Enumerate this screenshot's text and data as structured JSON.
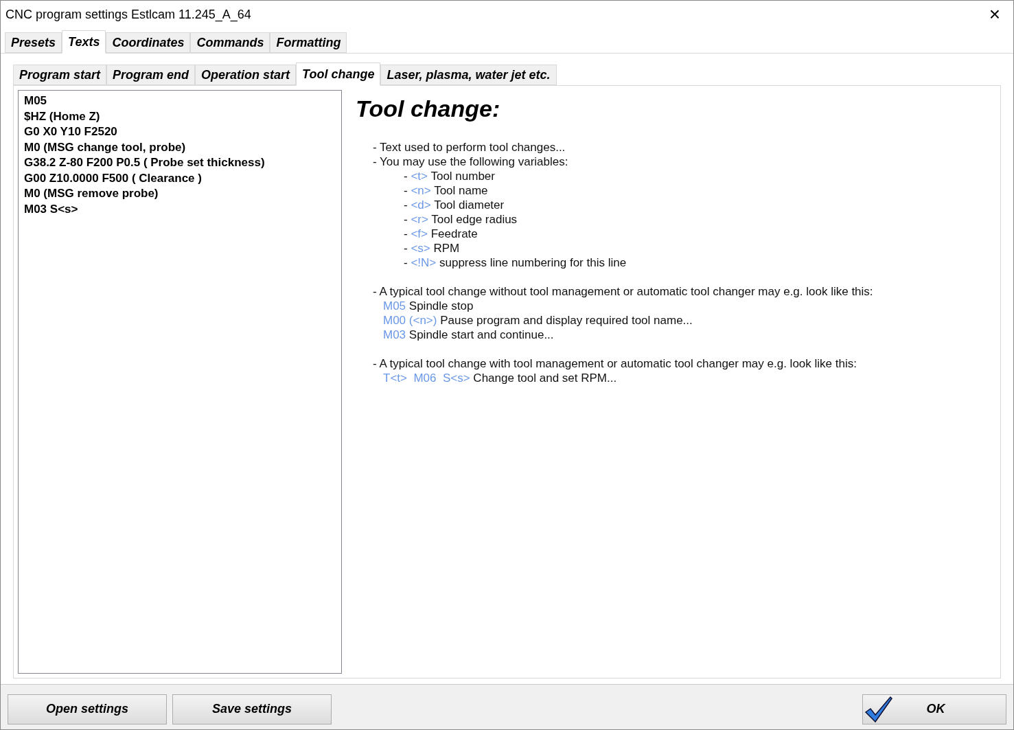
{
  "window": {
    "title": "CNC program settings Estlcam 11.245_A_64",
    "close": "×"
  },
  "tabs": [
    {
      "label": "Presets",
      "selected": false
    },
    {
      "label": "Texts",
      "selected": true
    },
    {
      "label": "Coordinates",
      "selected": false
    },
    {
      "label": "Commands",
      "selected": false
    },
    {
      "label": "Formatting",
      "selected": false
    }
  ],
  "subtabs": [
    {
      "label": "Program start",
      "selected": false
    },
    {
      "label": "Program end",
      "selected": false
    },
    {
      "label": "Operation start",
      "selected": false
    },
    {
      "label": "Tool change",
      "selected": true
    },
    {
      "label": "Laser, plasma, water jet etc.",
      "selected": false
    }
  ],
  "editor": {
    "lines": [
      "M05",
      "$HZ (Home Z)",
      "G0 X0 Y10 F2520",
      "M0 (MSG change tool, probe)",
      "G38.2 Z-80 F200 P0.5 ( Probe set thickness)",
      "G00 Z10.0000 F500 ( Clearance )",
      "M0 (MSG remove probe)",
      "M03 S<s>"
    ]
  },
  "help": {
    "title": "Tool change:",
    "lines": [
      {
        "kind": "bullet",
        "text": "- Text used to perform tool changes..."
      },
      {
        "kind": "bullet",
        "text": "- You may use the following variables:"
      },
      {
        "kind": "sub",
        "dash": "-",
        "code": "<t>",
        "text": "Tool number"
      },
      {
        "kind": "sub",
        "dash": "-",
        "code": "<n>",
        "text": "Tool name"
      },
      {
        "kind": "sub",
        "dash": "-",
        "code": "<d>",
        "text": "Tool diameter"
      },
      {
        "kind": "sub",
        "dash": "-",
        "code": "<r>",
        "text": "Tool edge radius"
      },
      {
        "kind": "sub",
        "dash": "-",
        "code": "<f>",
        "text": "Feedrate"
      },
      {
        "kind": "sub",
        "dash": "-",
        "code": "<s>",
        "text": "RPM"
      },
      {
        "kind": "sub",
        "dash": "-",
        "code": "<!N>",
        "text": "suppress line numbering for this line"
      },
      {
        "kind": "section",
        "text": "- A typical tool change without tool management or automatic tool changer may e.g. look like this:"
      },
      {
        "kind": "example",
        "code": "M05",
        "text": "Spindle stop"
      },
      {
        "kind": "example",
        "code": "M00 (<n>)",
        "text": "Pause program and display required tool name..."
      },
      {
        "kind": "example",
        "code": "M03",
        "text": "Spindle start and continue..."
      },
      {
        "kind": "section",
        "text": "- A typical tool change with tool management or automatic tool changer may e.g. look like this:"
      },
      {
        "kind": "example",
        "code": "T<t>  M06  S<s>",
        "text": "Change tool and set RPM..."
      }
    ]
  },
  "buttons": {
    "open": "Open settings",
    "save": "Save settings",
    "ok": "OK"
  }
}
